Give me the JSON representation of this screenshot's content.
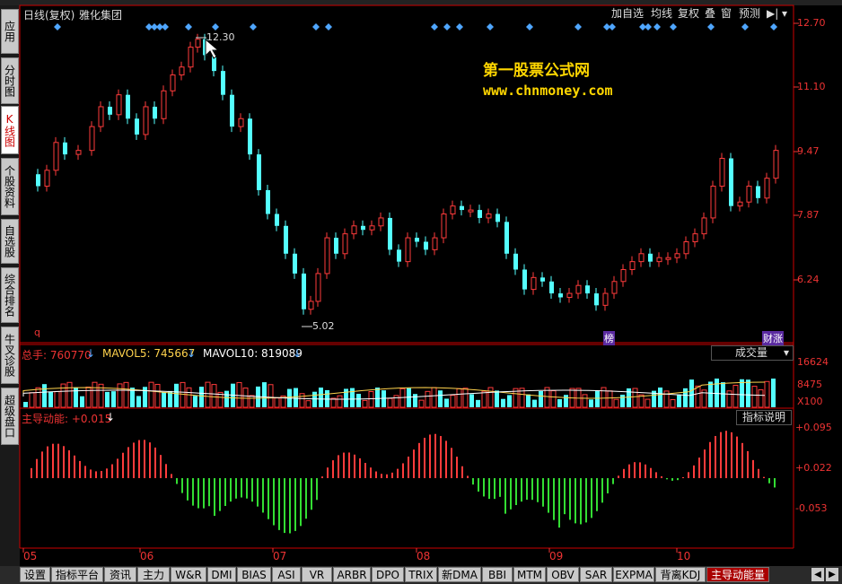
{
  "header": {
    "period": "日线(复权)",
    "stock_name": "雅化集团",
    "buttons": [
      "加自选",
      "均线",
      "复权",
      "叠",
      "窗",
      "预测"
    ]
  },
  "sidebar": {
    "items": [
      {
        "label": "应用"
      },
      {
        "label": "分时图"
      },
      {
        "label": "K线图",
        "active": true
      },
      {
        "label": "个股资料"
      },
      {
        "label": "自选股"
      },
      {
        "label": "综合排名"
      },
      {
        "label": "牛叉诊股"
      },
      {
        "label": "超级盘口"
      }
    ]
  },
  "price_axis": [
    "12.70",
    "11.10",
    "9.47",
    "7.87",
    "6.24"
  ],
  "annotations": {
    "high": "12.30",
    "low": "5.02",
    "q_marker": "q",
    "bang_marker": "榜",
    "caizhang_marker": "财涨"
  },
  "watermark": {
    "line1": "第一股票公式网",
    "line2": "www.chnmoney.com"
  },
  "volume": {
    "legend": [
      {
        "label": "总手: 760770",
        "color": "#e33"
      },
      {
        "label": "MAVOL5: 745667",
        "color": "#ffd34d"
      },
      {
        "label": "MAVOL10: 819089",
        "color": "#ffffff"
      }
    ],
    "selector": "成交量",
    "axis": [
      "16624",
      "8475",
      "X100"
    ]
  },
  "indicator": {
    "legend": "主导动能: +0.015",
    "help_button": "指标说明",
    "axis": [
      "+0.095",
      "+0.022",
      "-0.053"
    ]
  },
  "months": [
    "05",
    "06",
    "07",
    "08",
    "09",
    "10"
  ],
  "bottom_tabs": [
    "设置",
    "指标平台",
    "资讯",
    "主力",
    "W&R",
    "DMI",
    "BIAS",
    "ASI",
    "VR",
    "ARBR",
    "DPO",
    "TRIX",
    "新DMA",
    "BBI",
    "MTM",
    "OBV",
    "SAR",
    "EXPMA",
    "背离KDJ",
    "主导动能量"
  ],
  "active_bottom_tab": "主导动能量",
  "colors": {
    "up": "#ff3b3b",
    "down": "#54ffff",
    "frame": "#cc0000",
    "pos_bar": "#ff3b3b",
    "neg_bar": "#33dd33",
    "diamond": "#4fa6ff"
  }
}
